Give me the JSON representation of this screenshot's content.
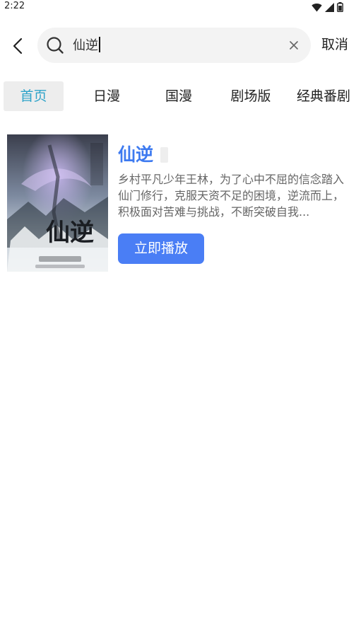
{
  "status_bar": {
    "time": "2:22"
  },
  "search": {
    "query": "仙逆",
    "cancel_label": "取消"
  },
  "tabs": [
    {
      "label": "首页",
      "active": true
    },
    {
      "label": "日漫",
      "active": false
    },
    {
      "label": "国漫",
      "active": false
    },
    {
      "label": "剧场版",
      "active": false
    },
    {
      "label": "经典番剧",
      "active": false
    }
  ],
  "results": [
    {
      "title": "仙逆",
      "description": "乡村平凡少年王林，为了心中不屈的信念踏入仙门修行，克服天资不足的困境，逆流而上，积极面对苦难与挑战，不断突破自我...",
      "play_label": "立即播放",
      "poster": {
        "title_art": "仙逆"
      }
    }
  ],
  "colors": {
    "accent": "#4a7ef5",
    "tab_active": "#2ea3c9",
    "title": "#3d7af0"
  },
  "icons": [
    "back-arrow-icon",
    "search-icon",
    "clear-icon",
    "wifi-icon",
    "signal-icon",
    "battery-icon"
  ]
}
